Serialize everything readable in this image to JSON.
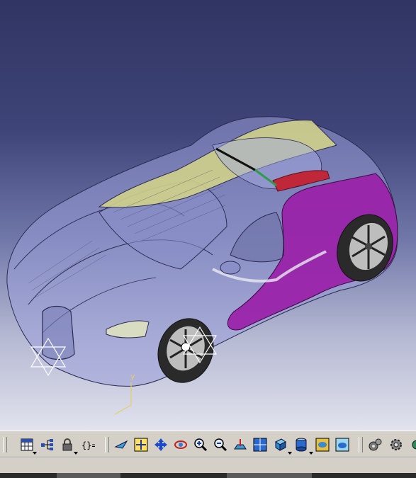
{
  "viewport": {
    "background_top": "#303563",
    "background_bottom": "#e2e3ee",
    "model": "car-body-wireframe",
    "axis_label_y": "y",
    "colors": {
      "body_fill": "#9a9fd8",
      "side_panel": "#9a1fa8",
      "roof_panel": "#cfd08a",
      "red_part": "#c0283a",
      "wheel": "#2a2a2a"
    }
  },
  "toolbar": {
    "buttons": [
      {
        "name": "grip-icon"
      },
      {
        "name": "table-icon"
      },
      {
        "name": "tree-icon"
      },
      {
        "name": "lock-icon"
      },
      {
        "name": "equation-icon"
      },
      {
        "name": "fly-mode-icon"
      },
      {
        "name": "fit-all-icon"
      },
      {
        "name": "pan-icon"
      },
      {
        "name": "rotate-icon"
      },
      {
        "name": "zoom-in-icon"
      },
      {
        "name": "zoom-out-icon"
      },
      {
        "name": "normal-view-icon"
      },
      {
        "name": "multi-view-icon"
      },
      {
        "name": "iso-view-icon"
      },
      {
        "name": "shading-icon"
      },
      {
        "name": "hide-show-icon"
      },
      {
        "name": "swap-visible-icon"
      },
      {
        "name": "settings-icon"
      },
      {
        "name": "gear-icon"
      },
      {
        "name": "tools-icon"
      }
    ]
  }
}
